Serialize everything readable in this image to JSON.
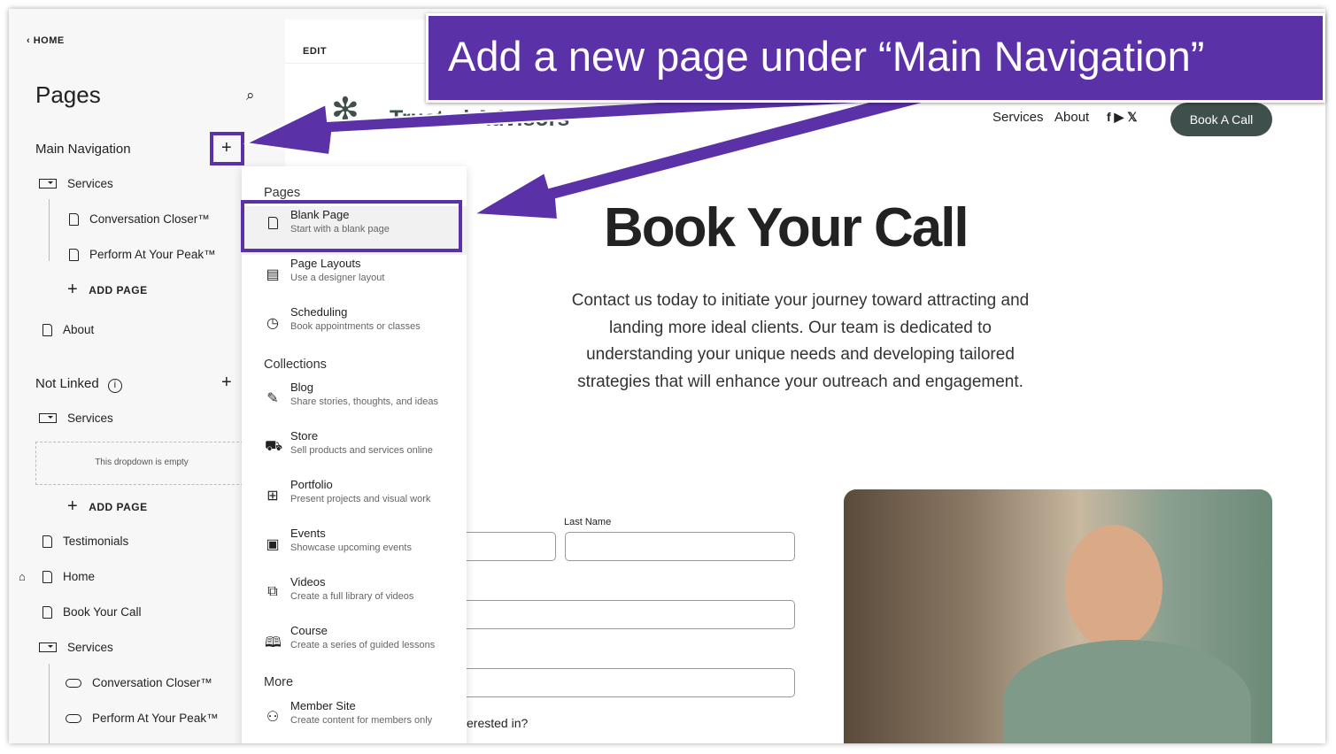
{
  "sidebar": {
    "back": "HOME",
    "title": "Pages",
    "main_nav": "Main Navigation",
    "not_linked": "Not Linked",
    "main_items": [
      {
        "label": "Services",
        "icon": "folder-icon"
      },
      {
        "label": "Conversation Closer™",
        "icon": "page-icon"
      },
      {
        "label": "Perform At Your Peak™",
        "icon": "page-icon"
      },
      {
        "label": "About",
        "icon": "page-icon"
      }
    ],
    "add_page": "ADD PAGE",
    "empty_dropdown": "This dropdown is empty",
    "not_linked_items": [
      {
        "label": "Services",
        "icon": "folder-icon"
      },
      {
        "label": "Testimonials",
        "icon": "page-icon"
      },
      {
        "label": "Home",
        "icon": "page-icon"
      },
      {
        "label": "Book Your Call",
        "icon": "page-icon"
      },
      {
        "label": "Services",
        "icon": "folder-icon"
      },
      {
        "label": "Conversation Closer™",
        "icon": "link-icon"
      },
      {
        "label": "Perform At Your Peak™",
        "icon": "link-icon"
      }
    ]
  },
  "preview": {
    "edit": "EDIT",
    "logo": "Trusted Advisors",
    "nav": [
      "Services",
      "About"
    ],
    "cta": "Book A Call",
    "heading": "Book Your Call",
    "body": "Contact us today to initiate your journey toward attracting and landing more ideal clients. Our team is dedicated to understanding your unique needs and developing tailored strategies that will enhance your outreach and engagement.",
    "last_name": "Last Name",
    "question": "erested in?"
  },
  "menu": {
    "pages_header": "Pages",
    "collections_header": "Collections",
    "more_header": "More",
    "pages": [
      {
        "title": "Blank Page",
        "sub": "Start with a blank page",
        "icon": "page-icon"
      },
      {
        "title": "Page Layouts",
        "sub": "Use a designer layout",
        "icon": "layout-icon"
      },
      {
        "title": "Scheduling",
        "sub": "Book appointments or classes",
        "icon": "clock-icon"
      }
    ],
    "collections": [
      {
        "title": "Blog",
        "sub": "Share stories, thoughts, and ideas",
        "icon": "pen-icon"
      },
      {
        "title": "Store",
        "sub": "Sell products and services online",
        "icon": "cart-icon"
      },
      {
        "title": "Portfolio",
        "sub": "Present projects and visual work",
        "icon": "grid-icon"
      },
      {
        "title": "Events",
        "sub": "Showcase upcoming events",
        "icon": "calendar-icon"
      },
      {
        "title": "Videos",
        "sub": "Create a full library of videos",
        "icon": "video-icon"
      },
      {
        "title": "Course",
        "sub": "Create a series of guided lessons",
        "icon": "book-icon"
      }
    ],
    "more": [
      {
        "title": "Member Site",
        "sub": "Create content for members only",
        "icon": "member-icon"
      }
    ]
  },
  "banner": "Add a new page under “Main Navigation”",
  "colors": {
    "accent": "#5b31a8",
    "cta": "#3f4f4b"
  }
}
